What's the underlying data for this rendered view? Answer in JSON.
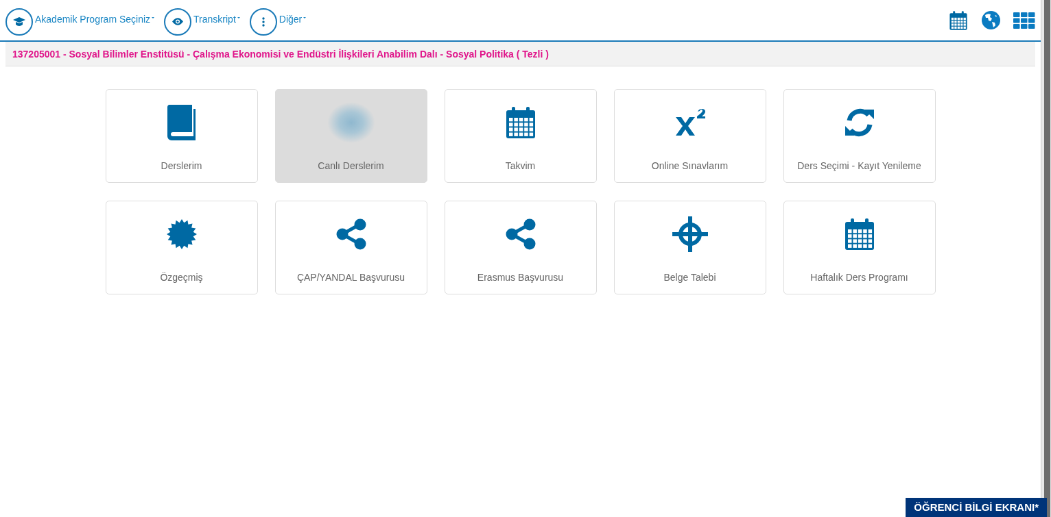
{
  "nav": {
    "menus": [
      {
        "kind": "cap",
        "label": "Akademik Program Seçiniz"
      },
      {
        "kind": "eye",
        "label": "Transkript"
      },
      {
        "kind": "dots",
        "label": "Diğer"
      }
    ]
  },
  "program_bar": {
    "text": "137205001 - Sosyal Bilimler Enstitüsü - Çalışma Ekonomisi ve Endüstri İlişkileri Anabilim Dalı - Sosyal Politika ( Tezli )"
  },
  "tiles": [
    {
      "kind": "book",
      "label": "Derslerim",
      "selected": false
    },
    {
      "kind": "blur",
      "label": "Canlı Derslerim",
      "selected": true
    },
    {
      "kind": "calendar",
      "label": "Takvim",
      "selected": false
    },
    {
      "kind": "superscript",
      "label": "Online Sınavlarım",
      "selected": false
    },
    {
      "kind": "refresh",
      "label": "Ders Seçimi - Kayıt Yenileme",
      "selected": false
    },
    {
      "kind": "badge",
      "label": "Özgeçmiş",
      "selected": false
    },
    {
      "kind": "share",
      "label": "ÇAP/YANDAL Başvurusu",
      "selected": false
    },
    {
      "kind": "share",
      "label": "Erasmus Başvurusu",
      "selected": false
    },
    {
      "kind": "crosshair",
      "label": "Belge Talebi",
      "selected": false
    },
    {
      "kind": "calendar2",
      "label": "Haftalık Ders Programı",
      "selected": false
    }
  ],
  "footer_badge": {
    "text": "ÖĞRENCİ BİLGİ EKRANI*"
  }
}
